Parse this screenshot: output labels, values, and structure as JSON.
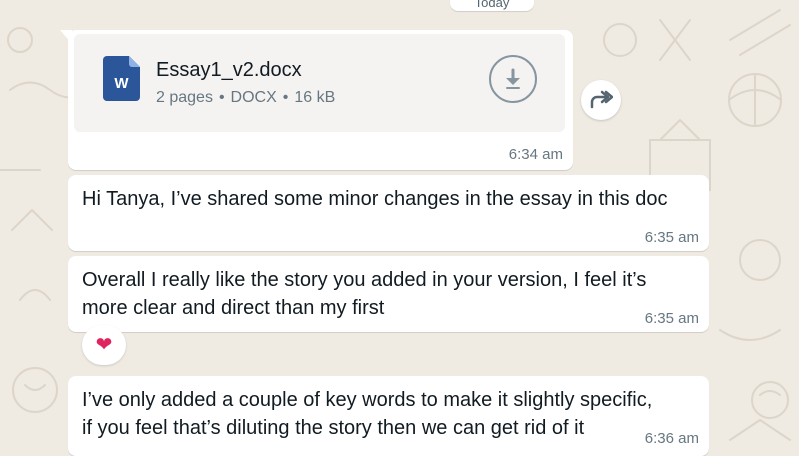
{
  "date_chip": "Today",
  "document": {
    "file_name": "Essay1_v2.docx",
    "pages": "2 pages",
    "type": "DOCX",
    "size": "16 kB",
    "icon_letter": "W",
    "time": "6:34 am"
  },
  "messages": [
    {
      "text": "Hi Tanya, I’ve shared some minor changes in the essay in this doc",
      "time": "6:35 am"
    },
    {
      "text": "Overall I really like the story you added in your version, I feel it’s\nmore clear and direct than my first",
      "time": "6:35 am",
      "reaction": "❤"
    },
    {
      "text": "I’ve only added a couple of key words to make it slightly specific,\nif you feel that’s diluting the story then we can get rid of it",
      "time": "6:36 am"
    }
  ],
  "colors": {
    "wallpaper": "#efeae2",
    "bubble": "#ffffff",
    "word_blue": "#2b579a",
    "meta_gray": "#667781"
  }
}
